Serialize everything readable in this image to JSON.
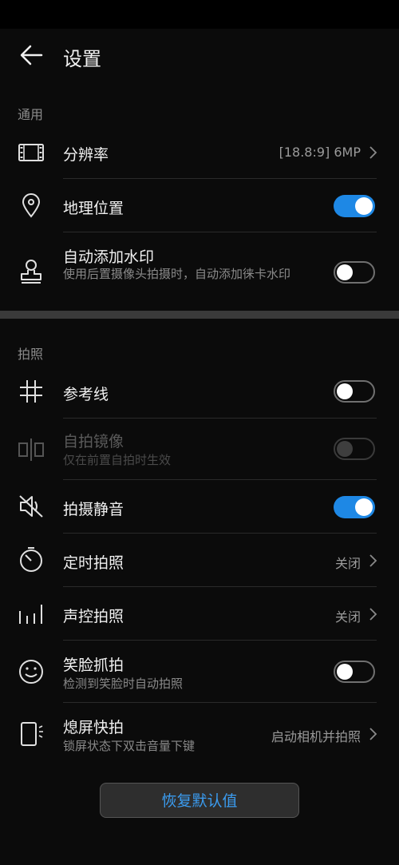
{
  "header": {
    "title": "设置"
  },
  "sections": {
    "general": "通用",
    "photo": "拍照"
  },
  "rows": {
    "resolution": {
      "label": "分辨率",
      "value": "[18.8:9] 6MP"
    },
    "location": {
      "label": "地理位置",
      "toggle": "on"
    },
    "watermark": {
      "label": "自动添加水印",
      "sub": "使用后置摄像头拍摄时，自动添加徕卡水印",
      "toggle": "off"
    },
    "grid": {
      "label": "参考线",
      "toggle": "off"
    },
    "mirror": {
      "label": "自拍镜像",
      "sub": "仅在前置自拍时生效",
      "toggle": "disabled"
    },
    "mute": {
      "label": "拍摄静音",
      "toggle": "on"
    },
    "timer": {
      "label": "定时拍照",
      "value": "关闭"
    },
    "voice": {
      "label": "声控拍照",
      "value": "关闭"
    },
    "smile": {
      "label": "笑脸抓拍",
      "sub": "检测到笑脸时自动拍照",
      "toggle": "off"
    },
    "ultra_snapshot": {
      "label": "熄屏快拍",
      "sub": "锁屏状态下双击音量下键",
      "value": "启动相机并拍照"
    }
  },
  "reset_button": "恢复默认值",
  "colors": {
    "accent": "#1e88e5",
    "background": "#0b0b0b",
    "reset_text": "#3b9cf0"
  }
}
